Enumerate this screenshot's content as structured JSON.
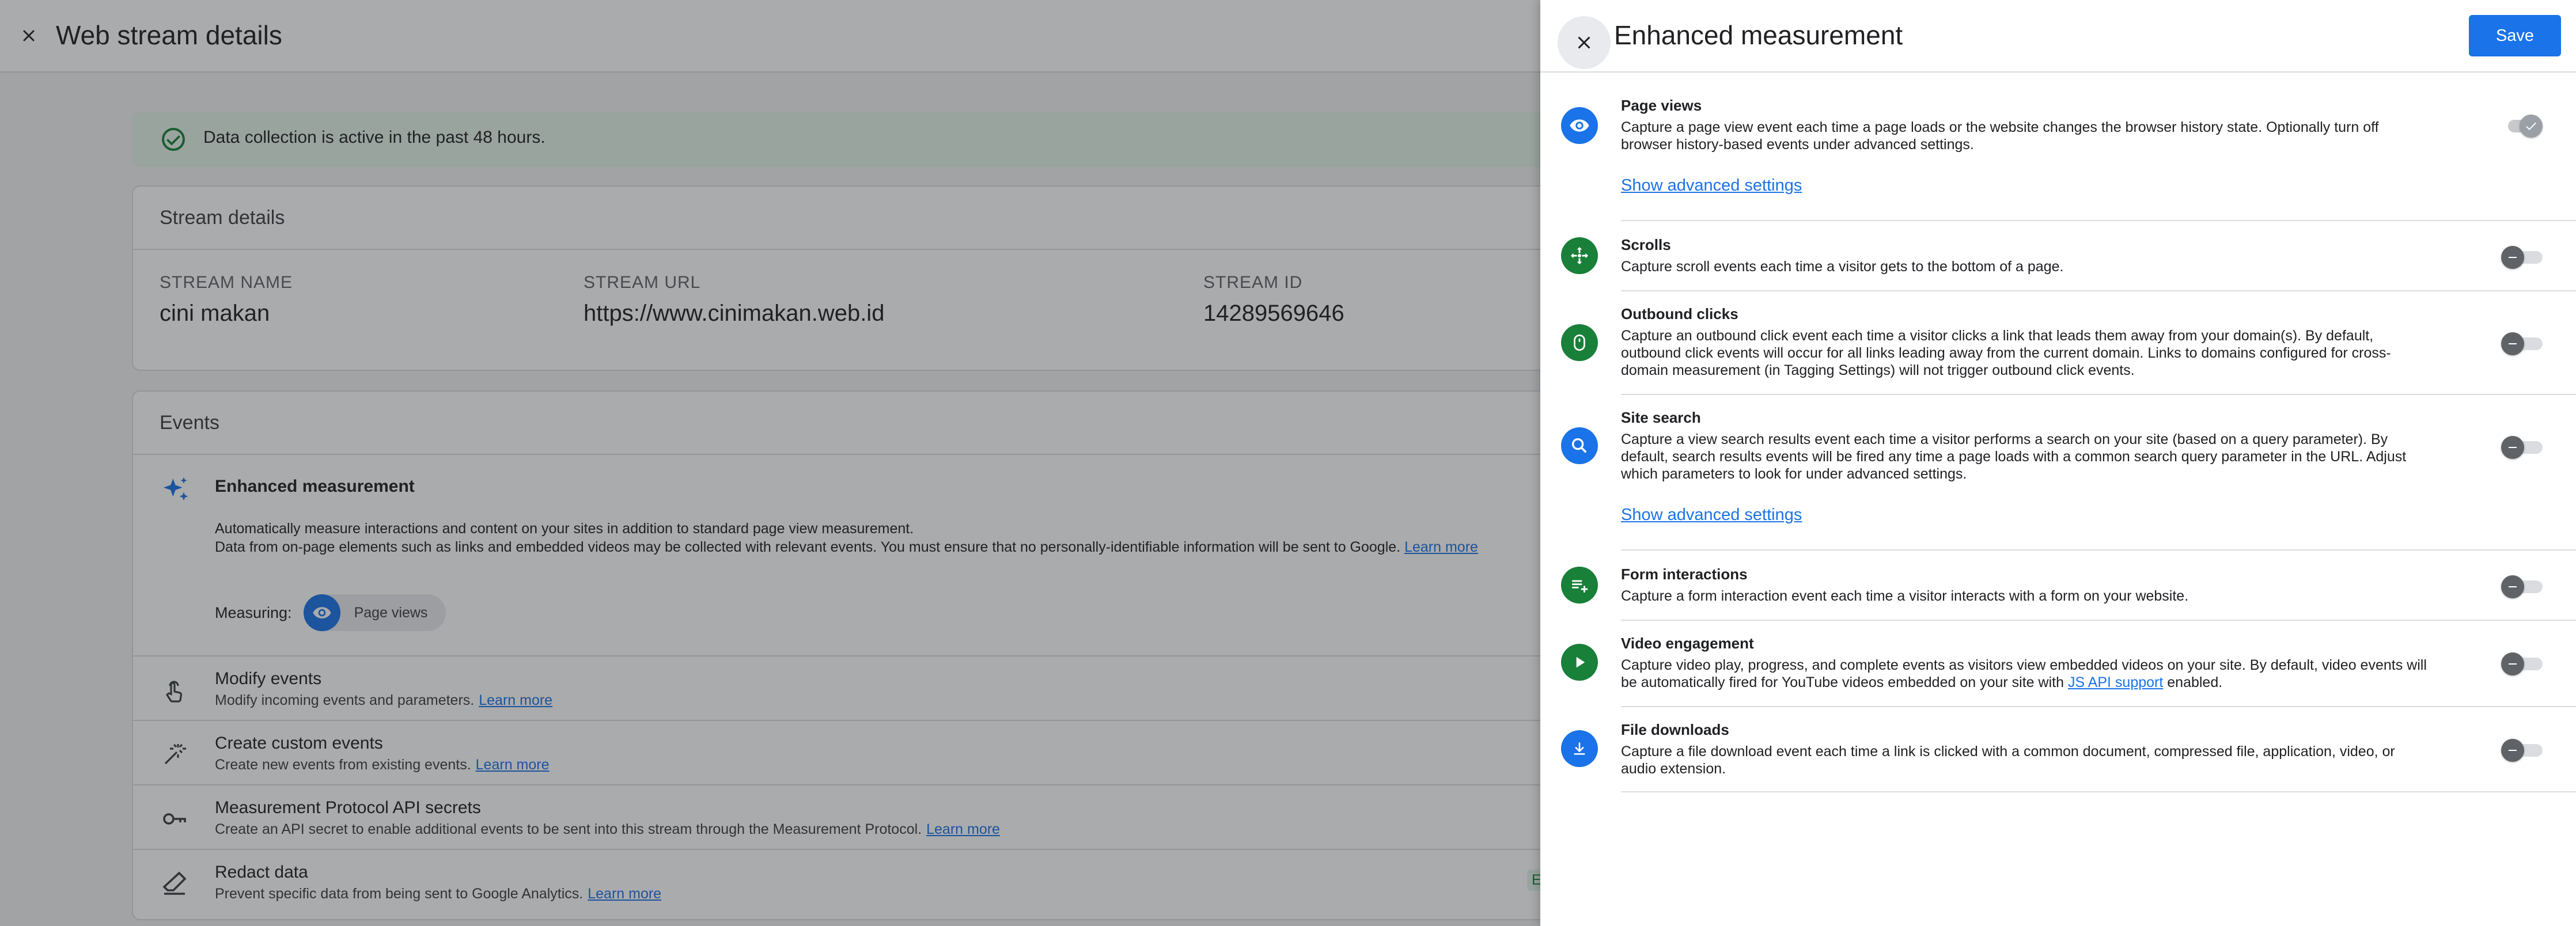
{
  "background": {
    "title": "Web stream details",
    "notice": "Data collection is active in the past 48 hours.",
    "stream_details": {
      "heading": "Stream details",
      "fields": [
        {
          "label": "STREAM NAME",
          "value": "cini makan"
        },
        {
          "label": "STREAM URL",
          "value": "https://www.cinimakan.web.id"
        },
        {
          "label": "STREAM ID",
          "value": "14289569646"
        }
      ]
    },
    "events": {
      "heading": "Events",
      "enhanced": {
        "title": "Enhanced measurement",
        "desc1": "Automatically measure interactions and content on your sites in addition to standard page view measurement.",
        "desc2": "Data from on-page elements such as links and embedded videos may be collected with relevant events. You must ensure that no personally-identifiable information will be sent to Google.",
        "learn_more": "Learn more",
        "measuring_label": "Measuring:",
        "chip_label": "Page views"
      },
      "rows": [
        {
          "title": "Modify events",
          "desc": "Modify incoming events and parameters.",
          "link": "Learn more"
        },
        {
          "title": "Create custom events",
          "desc": "Create new events from existing events.",
          "link": "Learn more"
        },
        {
          "title": "Measurement Protocol API secrets",
          "desc": "Create an API secret to enable additional events to be sent into this stream through the Measurement Protocol.",
          "link": "Learn more"
        },
        {
          "title": "Redact data",
          "desc": "Prevent specific data from being sent to Google Analytics.",
          "link": "Learn more"
        }
      ],
      "partial_badge": "En"
    }
  },
  "panel": {
    "title": "Enhanced measurement",
    "save_label": "Save",
    "settings": [
      {
        "title": "Page views",
        "desc": "Capture a page view event each time a page loads or the website changes the browser history state. Optionally turn off browser history-based events under advanced settings.",
        "advanced_link": "Show advanced settings",
        "enabled": true
      },
      {
        "title": "Scrolls",
        "desc": "Capture scroll events each time a visitor gets to the bottom of a page.",
        "enabled": false
      },
      {
        "title": "Outbound clicks",
        "desc": "Capture an outbound click event each time a visitor clicks a link that leads them away from your domain(s). By default, outbound click events will occur for all links leading away from the current domain. Links to domains configured for cross-domain measurement (in Tagging Settings) will not trigger outbound click events.",
        "enabled": false
      },
      {
        "title": "Site search",
        "desc": "Capture a view search results event each time a visitor performs a search on your site (based on a query parameter). By default, search results events will be fired any time a page loads with a common search query parameter in the URL. Adjust which parameters to look for under advanced settings.",
        "advanced_link": "Show advanced settings",
        "enabled": false
      },
      {
        "title": "Form interactions",
        "desc": "Capture a form interaction event each time a visitor interacts with a form on your website.",
        "enabled": false
      },
      {
        "title": "Video engagement",
        "desc_before": "Capture video play, progress, and complete events as visitors view embedded videos on your site. By default, video events will be automatically fired for YouTube videos embedded on your site with",
        "desc_link": "JS API support",
        "desc_after": "enabled.",
        "enabled": false
      },
      {
        "title": "File downloads",
        "desc": "Capture a file download event each time a link is clicked with a common document, compressed file, application, video, or audio extension.",
        "enabled": false
      }
    ]
  },
  "colors": {
    "primary": "#1a73e8",
    "green": "#188038",
    "success_bg": "#e6f4ea"
  }
}
